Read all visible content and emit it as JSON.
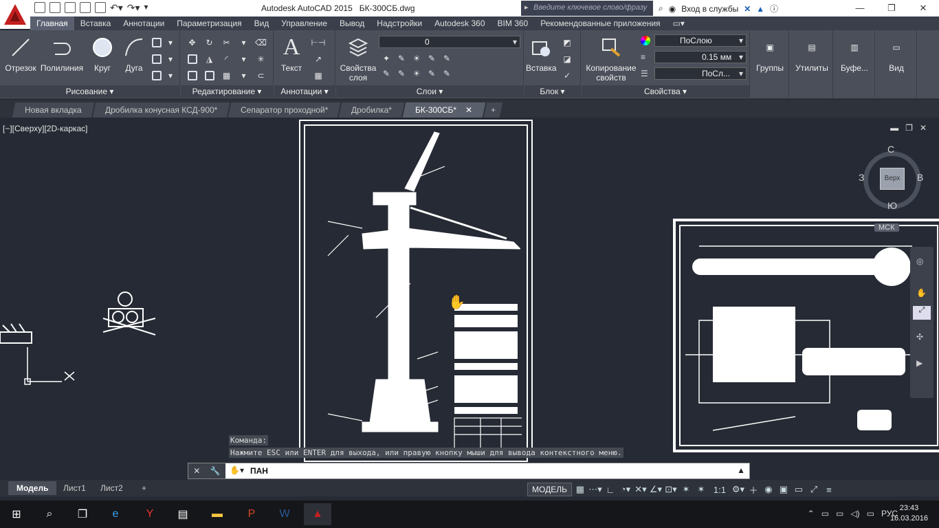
{
  "title": {
    "app": "Autodesk AutoCAD 2015",
    "file": "БК-300СБ.dwg"
  },
  "search": {
    "placeholder": "Введите ключевое слово/фразу"
  },
  "account": {
    "signin": "Вход в службы"
  },
  "ribbon_tabs": [
    "Главная",
    "Вставка",
    "Аннотации",
    "Параметризация",
    "Вид",
    "Управление",
    "Вывод",
    "Надстройки",
    "Autodesk 360",
    "BIM 360",
    "Рекомендованные приложения"
  ],
  "panels": {
    "draw": {
      "title": "Рисование",
      "line": "Отрезок",
      "polyline": "Полилиния",
      "circle": "Круг",
      "arc": "Дуга"
    },
    "modify": {
      "title": "Редактирование"
    },
    "annotation": {
      "title": "Аннотации",
      "text": "Текст"
    },
    "layers": {
      "title": "Слои",
      "properties": "Свойства слоя",
      "current_layer": "0"
    },
    "block": {
      "title": "Блок",
      "insert": "Вставка"
    },
    "properties": {
      "title": "Свойства",
      "match": "Копирование свойств",
      "color": "ПоСлою",
      "lineweight": "0.15 мм",
      "linetype": "ПоСл..."
    },
    "groups": "Группы",
    "utilities": "Утилиты",
    "clipboard": "Буфе...",
    "view": "Вид"
  },
  "doc_tabs": [
    "Новая вкладка",
    "Дробилка конусная КСД-900*",
    "Сепаратор проходной*",
    "Дробилка*",
    "БК-300СБ*"
  ],
  "viewport": {
    "label": "[−][Сверху][2D-каркас]"
  },
  "viewcube": {
    "north": "С",
    "south": "Ю",
    "west": "З",
    "east": "В",
    "face": "Верх",
    "wcs": "МСК"
  },
  "command": {
    "history_label": "Команда:",
    "history_msg": "Нажмите ESC или ENTER для выхода, или правую кнопку мыши для вывода контекстного меню.",
    "current": "ПАН"
  },
  "layout_tabs": [
    "Модель",
    "Лист1",
    "Лист2"
  ],
  "status": {
    "model": "МОДЕЛЬ",
    "scale": "1:1"
  },
  "taskbar": {
    "lang": "РУС",
    "time": "23:43",
    "date": "16.03.2016"
  },
  "colors": {
    "ribbon": "#4a4f5a",
    "canvas": "#252a34",
    "accent": "#c3201f"
  }
}
